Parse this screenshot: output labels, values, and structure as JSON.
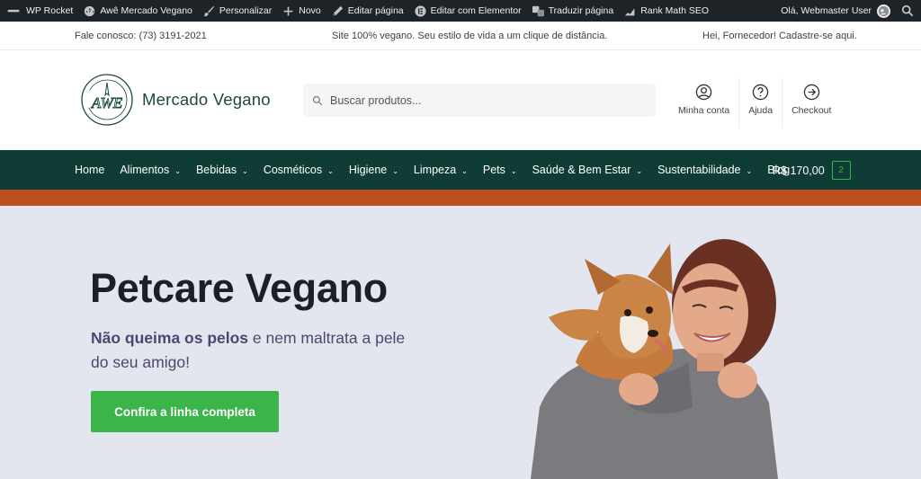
{
  "admin_bar": {
    "items": [
      "WP Rocket",
      "Awê Mercado Vegano",
      "Personalizar",
      "Novo",
      "Editar página",
      "Editar com Elementor",
      "Traduzir página",
      "Rank Math SEO"
    ],
    "greeting": "Olá, Webmaster User",
    "icons": [
      "wordpress-icon",
      "dashboard-icon",
      "brush-icon",
      "plus-icon",
      "pencil-icon",
      "elementor-icon",
      "translate-icon",
      "rankmath-icon",
      "search-icon"
    ]
  },
  "top_bar": {
    "contact": "Fale conosco: (73) 3191-2021",
    "tagline": "Site 100% vegano. Seu estilo de vida a um clique de distância.",
    "supplier": "Hei, Fornecedor! Cadastre-se aqui."
  },
  "header": {
    "logo_mark": "AWE",
    "logo_name": "Mercado Vegano",
    "search_placeholder": "Buscar produtos...",
    "account_label": "Minha conta",
    "help_label": "Ajuda",
    "checkout_label": "Checkout"
  },
  "nav": {
    "items": [
      {
        "label": "Home",
        "has_dropdown": false
      },
      {
        "label": "Alimentos",
        "has_dropdown": true
      },
      {
        "label": "Bebidas",
        "has_dropdown": true
      },
      {
        "label": "Cosméticos",
        "has_dropdown": true
      },
      {
        "label": "Higiene",
        "has_dropdown": true
      },
      {
        "label": "Limpeza",
        "has_dropdown": true
      },
      {
        "label": "Pets",
        "has_dropdown": true
      },
      {
        "label": "Saúde & Bem Estar",
        "has_dropdown": true
      },
      {
        "label": "Sustentabilidade",
        "has_dropdown": true
      },
      {
        "label": "Blog",
        "has_dropdown": false
      }
    ],
    "cart_total": "R$ 170,00",
    "cart_count": "2"
  },
  "hero": {
    "title": "Petcare Vegano",
    "subtitle_bold": "Não queima os pelos",
    "subtitle_rest": " e nem maltrata a pele do seu amigo!",
    "cta_label": "Confira a linha completa"
  },
  "colors": {
    "admin_bar": "#1d2327",
    "nav_bg": "#0f3d36",
    "accent_bar": "#b94e1f",
    "cta_green": "#3bb54a",
    "hero_bg": "#e3e6ee",
    "brand_text": "#1c4a3f"
  }
}
